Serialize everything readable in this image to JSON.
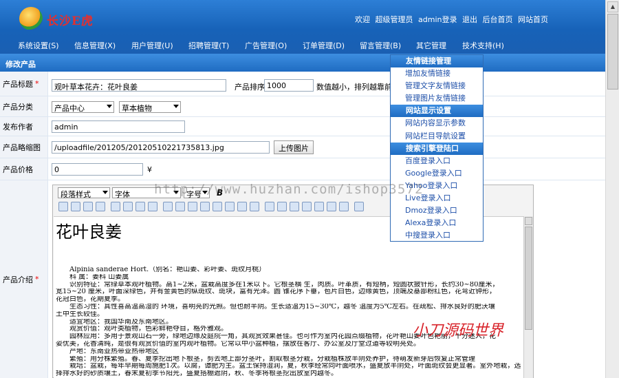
{
  "header": {
    "logo_text": "长沙E虎",
    "links": [
      "欢迎",
      "超级管理员",
      "admin登录",
      "退出",
      "后台首页",
      "网站首页"
    ]
  },
  "nav": {
    "items": [
      "系统设置(S)",
      "信息管理(X)",
      "用户管理(U)",
      "招聘管理(T)",
      "广告管理(O)",
      "订单管理(D)",
      "留言管理(B)",
      "其它管理",
      "技术支持(H)"
    ]
  },
  "section_title": "修改产品",
  "form": {
    "title_label": "产品标题",
    "title_value": "观叶草本花卉：花叶良姜",
    "order_label": "产品排序",
    "order_value": "1000",
    "order_hint": "数值越小，排列越靠前",
    "category_label": "产品分类",
    "category_main": "产品中心",
    "category_sub": "草本植物",
    "author_label": "发布作者",
    "author_value": "admin",
    "thumb_label": "产品略缩图",
    "thumb_value": "/uploadfile/201205/20120510221735813.jpg",
    "upload_button": "上传图片",
    "price_label": "产品价格",
    "price_value": "0",
    "price_unit": "¥",
    "intro_label": "产品介绍",
    "required_mark": "*"
  },
  "editor": {
    "paragraph_style": "段落样式",
    "font": "字体",
    "size": "字号",
    "bold": "B",
    "heading": "花叶良姜",
    "body_lines": [
      "Alpinia sanderae Hort.（别名：艳山姜、彩叶姜、斑纹月桃）",
      "科 属：姜科 山姜属",
      "识别特征：常绿草本观叶植物。高1~2米，盆栽高度多在1米以下。它根茎横 生，肉质。叶革质，有短柄，短圆状披针形，长约30~80厘米，",
      "宽15~20 厘米，叶面深绿色，并有金黄色的纵斑纹、斑块，富有光泽。圆 锥花序下垂，苞片白色，边缘黄色，顶端及基部粉红色，花弯近钟形，",
      "花冠白色，花期夏季。",
      "生态习性：其性喜高温高湿的 环境，喜明亮的光照。但也耐半阴。生长适温为15~30℃，越冬 温度为5℃左右。在疏松、排水良好的肥沃壤",
      "土中生长较佳。",
      "适宜地区：我国华南及东南地区。",
      "观赏价值：观叶类植物，色彩鲜艳夺目，格外雅观。",
      "园林应用：多用于景观山石一旁，绿地边缘及庭院一角，其观赏效果甚佳。也可作为室内花园点缀植物，花叶艳山姜叶色艳丽，十分迷人，花",
      "姿优美，花香清纯，是很有观赏价值的室内观叶植物。它常以中小盆种植，摆放在客厅、办公室及厅堂过道等较明亮处。",
      "产地：东南亚热带亚热带地区",
      "繁殖：用分株繁殖。春、夏季挖出地下根茎，剪去地上部分茎叶，割取根茎分栽，分栽植株放半阴处养护，待萌发新芽后恢复正常管理",
      "栽培：盆栽，每年早期每周施肥1次。以腐，谭肥为主。盆土保持湿润，夏，秋季经常向叶面喷水，盛夏放半阴处，叶面斑纹会更显著。室外地栽，选",
      "择排水好的砂质壤土，春末夏初季节阳光，盛夏搭棚遮阴，秋、冬季将根茎挖出放室内越冬。"
    ]
  },
  "dropdown": {
    "items": [
      {
        "label": "友情链接管理",
        "header": true
      },
      {
        "label": "增加友情链接",
        "header": false
      },
      {
        "label": "管理文字友情链接",
        "header": false
      },
      {
        "label": "管理图片友情链接",
        "header": false
      },
      {
        "label": "网站显示设置",
        "header": true
      },
      {
        "label": "网站内容显示参数",
        "header": false
      },
      {
        "label": "网站栏目导航设置",
        "header": false
      },
      {
        "label": "搜索引擎登陆口",
        "header": true
      },
      {
        "label": "百度登录入口",
        "header": false
      },
      {
        "label": "Google登录入口",
        "header": false
      },
      {
        "label": "Yahoo登录入口",
        "header": false
      },
      {
        "label": "Live登录入口",
        "header": false
      },
      {
        "label": "Dmoz登录入口",
        "header": false
      },
      {
        "label": "Alexa登录入口",
        "header": false
      },
      {
        "label": "中搜登录入口",
        "header": false
      }
    ]
  },
  "watermark": "http://www.huzhan.com/ishop3572",
  "brand_mark": "小刀源码世界"
}
